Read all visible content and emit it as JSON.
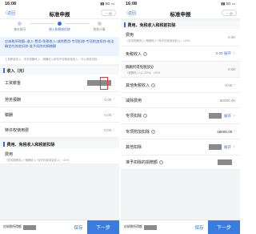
{
  "status": {
    "time": "16:08",
    "signal": "▮▮ 5G ▭"
  },
  "navbar": {
    "back": "〈返回",
    "title": "标准申报",
    "more": "··· ◎"
  },
  "steps": [
    "基本情况",
    "收入和税前扣除",
    "税款计算"
  ],
  "notice": {
    "text": "应纳税所得额=收入-费用-免税收入-减除费用-专项扣除-专项附加扣除-依法确定的其他扣除-准予扣除的捐赠额",
    "sub": "工资薪金收入、劳务报酬收入、稿酬收入和特许权使用费收入，可以申报扣除…"
  },
  "left": {
    "section_income": "收入（元）",
    "rows": [
      {
        "label": "工资薪金",
        "value": ""
      },
      {
        "label": "劳务报酬",
        "value": "0.00"
      },
      {
        "label": "稿酬",
        "value": "0.00"
      },
      {
        "label": "特许权使用费",
        "value": "0.00"
      }
    ],
    "section_deduction": "费用、免税收入和税前扣除",
    "fee_label": "费用",
    "fee_sub": "（劳务报酬收入+稿酬收入+特许权使用费收入）×20%",
    "fee_value": "0.00"
  },
  "right": {
    "section_deduction": "费用、免税收入和税前扣除",
    "fee_label": "费用",
    "fee_sub": "（劳务报酬收入+稿酬收入+特许权使用费收入）×20%",
    "fee_value": "0.00",
    "exempt_label": "免税收入",
    "exempt_value": "0.00 展开",
    "exempt_sub_label": "稿酬所得免税部分",
    "exempt_sub_desc": "（稿酬收入×(1-20%)）×30%",
    "exempt_sub_value": "0.00",
    "other_exempt_label": "其他免税收入",
    "other_exempt_value": "0.00",
    "deduct_fee_label": "减除费用",
    "deduct_fee_value": "60000.00",
    "special_label": "专项扣除",
    "special_value": "展开",
    "special_add_label": "专项附加扣除",
    "special_add_value": "18000.00",
    "other_label": "其他扣除",
    "other_value": "展开",
    "donation_label": "准予扣除的捐赠额",
    "donation_value": ""
  },
  "bottombar": {
    "tax_label": "应纳税所得额",
    "save": "保存",
    "next": "下一步"
  },
  "colors": {
    "accent": "#3b7ce0",
    "highlight": "#e53935"
  }
}
